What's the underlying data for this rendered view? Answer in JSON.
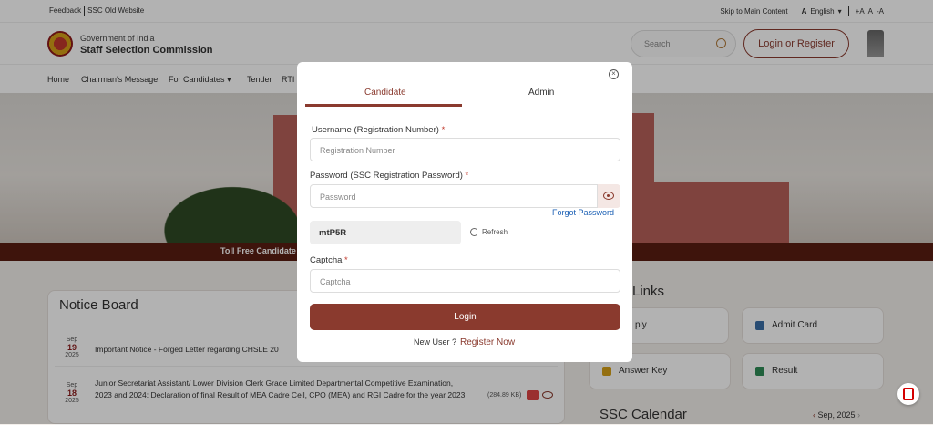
{
  "topbar": {
    "feedback": "Feedback",
    "old_site": "SSC Old Website",
    "skip": "Skip to Main Content",
    "lang": "English",
    "font_plus": "+A",
    "font_normal": "A",
    "font_minus": "-A"
  },
  "header": {
    "org_line1": "Government of India",
    "org_line2": "Staff Selection Commission",
    "search_placeholder": "Search",
    "login_register": "Login or Register"
  },
  "nav": {
    "items": [
      "Home",
      "Chairman's Message",
      "For Candidates",
      "Tender",
      "RTI"
    ]
  },
  "hero": {
    "toll_free": "Toll Free Candidate"
  },
  "notice": {
    "title": "Notice Board",
    "rows": [
      {
        "month": "Sep",
        "day": "19",
        "year": "2025",
        "text": "Important Notice - Forged Letter regarding CHSLE 20"
      },
      {
        "month": "Sep",
        "day": "18",
        "year": "2025",
        "text": "Junior Secretariat Assistant/ Lower Division Clerk Grade Limited Departmental Competitive Examination, 2023 and 2024: Declaration of final Result of MEA Cadre Cell, CPO (MEA) and RGI Cadre for the year 2023",
        "size": "(284.89 KB)"
      }
    ]
  },
  "quick_links": {
    "title": "Links",
    "items": [
      "ply",
      "Admit Card",
      "Answer Key",
      "Result"
    ]
  },
  "calendar": {
    "title": "SSC Calendar",
    "month": "Sep, 2025"
  },
  "modal": {
    "tabs": [
      "Candidate",
      "Admin"
    ],
    "username_label": "Username (Registration Number)",
    "username_placeholder": "Registration Number",
    "password_label": "Password (SSC Registration Password)",
    "password_placeholder": "Password",
    "forgot": "Forgot Password",
    "captcha_code": "mtP5R",
    "refresh": "Refresh",
    "captcha_label": "Captcha",
    "captcha_placeholder": "Captcha",
    "required_mark": "*",
    "login_button": "Login",
    "new_user": "New User ?",
    "register_now": "Register Now",
    "close": "×"
  },
  "colors": {
    "brand": "#8a3a2e",
    "link": "#1a5fb4",
    "band": "#5a1d12"
  }
}
